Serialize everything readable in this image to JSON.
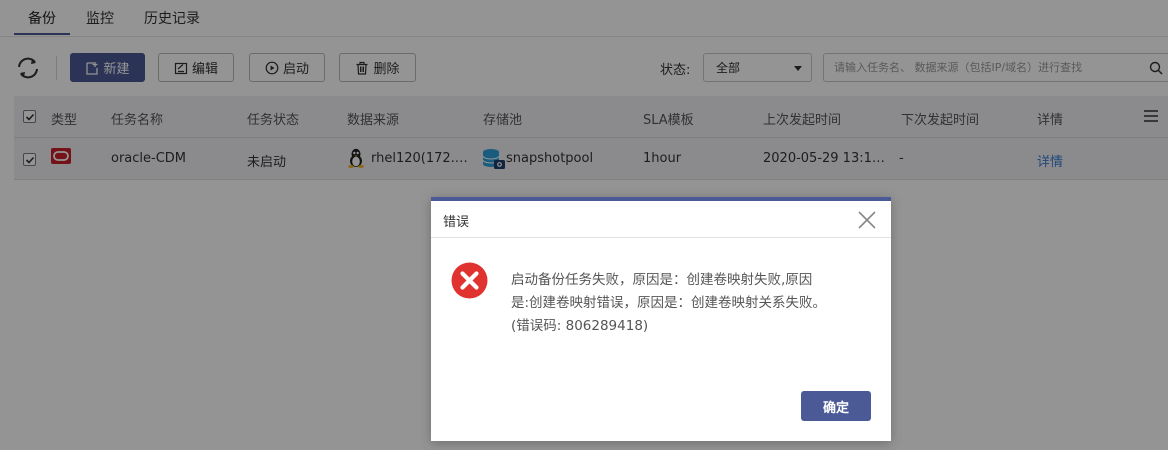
{
  "tabs": [
    {
      "label": "备份"
    },
    {
      "label": "监控"
    },
    {
      "label": "历史记录"
    }
  ],
  "toolbar": {
    "refresh_icon": "refresh-icon",
    "new_label": "新建",
    "edit_label": "编辑",
    "start_label": "启动",
    "delete_label": "删除",
    "status_label": "状态:",
    "status_value": "全部",
    "search_placeholder": "请输入任务名、 数据来源（包括IP/域名）进行查找"
  },
  "table": {
    "headers": [
      "类型",
      "任务名称",
      "任务状态",
      "数据来源",
      "存储池",
      "SLA模板",
      "上次发起时间",
      "下次发起时间",
      "详情"
    ],
    "rows": [
      {
        "type_icon": "oracle-icon",
        "name": "oracle-CDM",
        "status": "未启动",
        "source": "rhel120(172.…",
        "pool": "snapshotpool",
        "sla": "1hour",
        "last_time": "2020-05-29 13:1…",
        "next_time": "-",
        "detail": "详情"
      }
    ]
  },
  "dialog": {
    "title": "错误",
    "message_line1": "启动备份任务失败，原因是：创建卷映射失败,原因",
    "message_line2": "是:创建卷映射错误，原因是：创建卷映射关系失败。",
    "message_line3": "(错误码: 806289418)",
    "ok_label": "确定"
  },
  "colors": {
    "primary": "#4b5a96",
    "link": "#3a7bd5",
    "error": "#e0322f",
    "oracle": "#c8202a"
  }
}
